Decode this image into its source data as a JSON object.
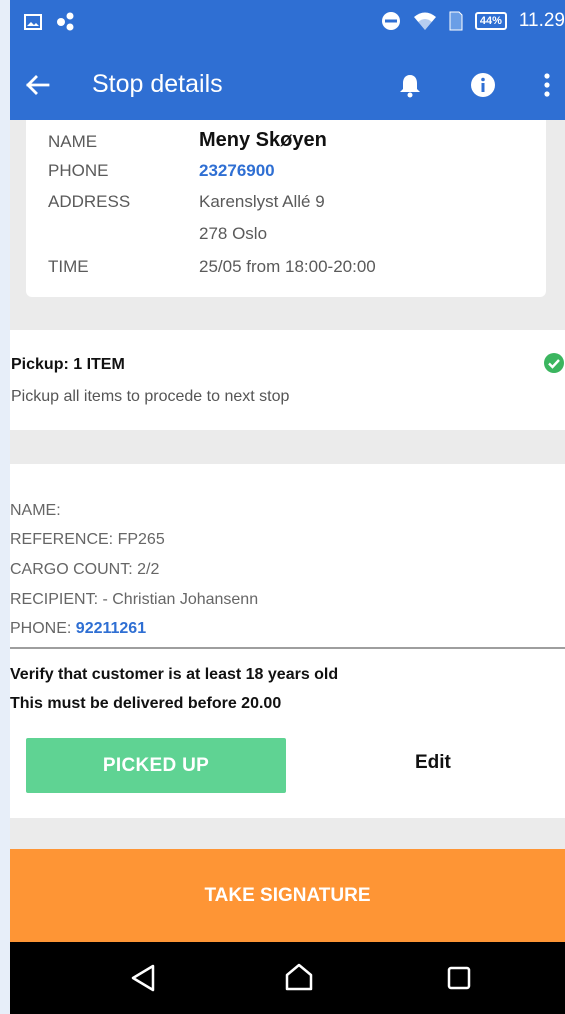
{
  "status_bar": {
    "time": "11.29",
    "battery": "44%",
    "icons": [
      "image-icon",
      "share-icon",
      "dnd-icon",
      "wifi-icon",
      "sim-icon",
      "battery-icon"
    ]
  },
  "app_bar": {
    "title": "Stop details",
    "icons": [
      "back-arrow-icon",
      "bell-icon",
      "info-icon",
      "more-vertical-icon"
    ]
  },
  "stop": {
    "name_label": "NAME",
    "name": "Meny Skøyen",
    "phone_label": "PHONE",
    "phone": "23276900",
    "address_label": "ADDRESS",
    "address_line1": "Karenslyst Allé 9",
    "address_line2": "278 Oslo",
    "time_label": "TIME",
    "time": "25/05 from 18:00-20:00"
  },
  "pickup": {
    "title": "Pickup: 1 ITEM",
    "subtitle": "Pickup all items to procede to next stop",
    "status_icon": "check-circle-icon",
    "status_color": "#3bb55f"
  },
  "item": {
    "name": "NAME:",
    "reference": "REFERENCE: FP265",
    "cargo_count": "CARGO COUNT: 2/2",
    "recipient": "RECIPIENT: - Christian Johansenn",
    "phone_label": "PHONE: ",
    "phone": "92211261",
    "note1": "Verify that customer is at least 18 years old",
    "note2": "This must be delivered before 20.00",
    "picked_up_label": "PICKED UP",
    "edit_label": "Edit"
  },
  "signature": {
    "label": "TAKE SIGNATURE"
  },
  "colors": {
    "primary": "#2f6fd3",
    "accent_orange": "#fe9535",
    "success_green": "#5fd393"
  },
  "nav_bar": {
    "icons": [
      "nav-back-icon",
      "nav-home-icon",
      "nav-recents-icon"
    ]
  }
}
